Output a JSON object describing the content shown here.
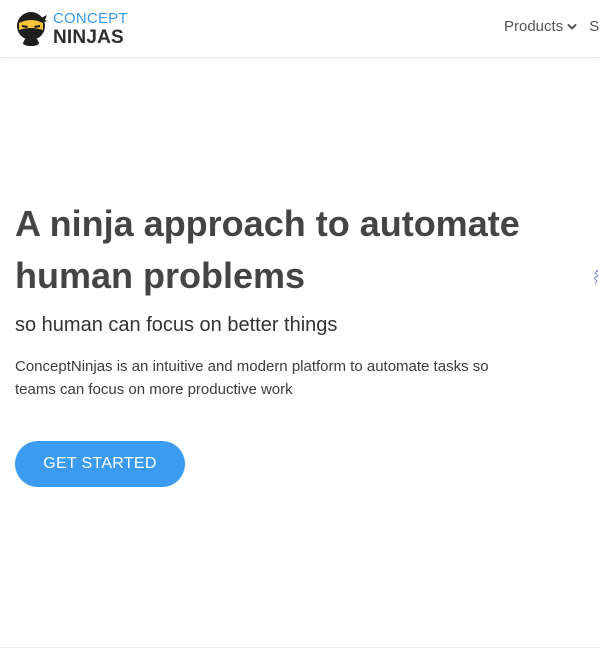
{
  "header": {
    "logo": {
      "top_text": "CONCEPT",
      "bottom_text": "NINJAS",
      "icon": "ninja-mascot-icon"
    },
    "nav": {
      "products_label": "Products",
      "products_icon": "chevron-down-icon",
      "next_item_label": "S"
    }
  },
  "hero": {
    "headline": "A ninja approach to automate human problems",
    "subheadline": "so human can focus on better things",
    "description": "ConceptNinjas is an intuitive and modern platform to automate tasks so teams can focus on more productive work",
    "cta_label": "GET STARTED"
  },
  "colors": {
    "accent": "#3b9bf0",
    "logo_blue": "#3a98ec",
    "headline": "#444444",
    "mascot_mask": "#f6c33a"
  }
}
